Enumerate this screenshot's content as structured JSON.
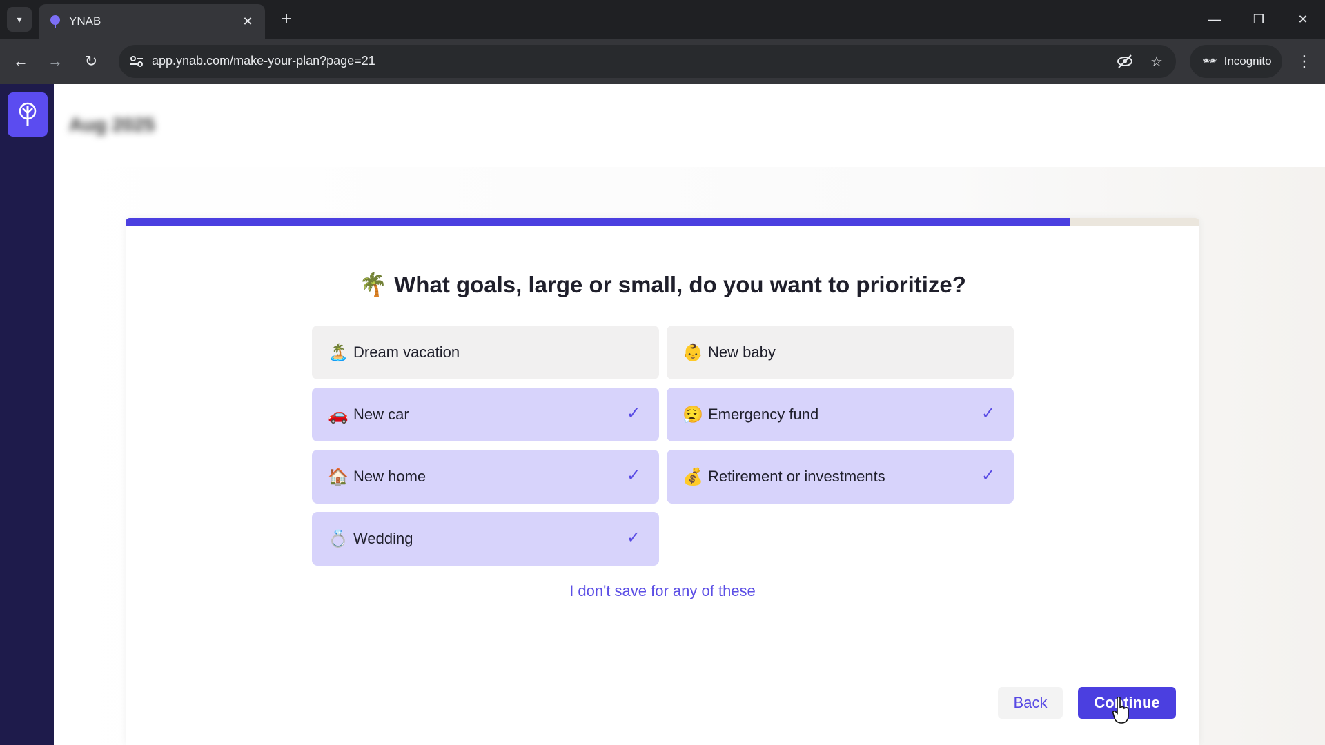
{
  "browser": {
    "tab_title": "YNAB",
    "url": "app.ynab.com/make-your-plan?page=21",
    "incognito_label": "Incognito"
  },
  "app": {
    "month_label": "Aug 2025",
    "brand_color": "#4b3fe0",
    "sidebar_color": "#1e1b4b"
  },
  "wizard": {
    "progress_percent": 88,
    "heading_emoji": "🌴",
    "heading": "What goals, large or small, do you want to prioritize?",
    "options": [
      {
        "emoji": "🏝️",
        "label": "Dream vacation",
        "selected": false
      },
      {
        "emoji": "👶",
        "label": "New baby",
        "selected": false
      },
      {
        "emoji": "🚗",
        "label": "New car",
        "selected": true
      },
      {
        "emoji": "😮‍💨",
        "label": "Emergency fund",
        "selected": true
      },
      {
        "emoji": "🏠",
        "label": "New home",
        "selected": true
      },
      {
        "emoji": "💰",
        "label": "Retirement or investments",
        "selected": true
      },
      {
        "emoji": "💍",
        "label": "Wedding",
        "selected": true
      }
    ],
    "check_glyph": "✓",
    "no_save_link": "I don't save for any of these",
    "back_label": "Back",
    "continue_label": "Continue"
  }
}
